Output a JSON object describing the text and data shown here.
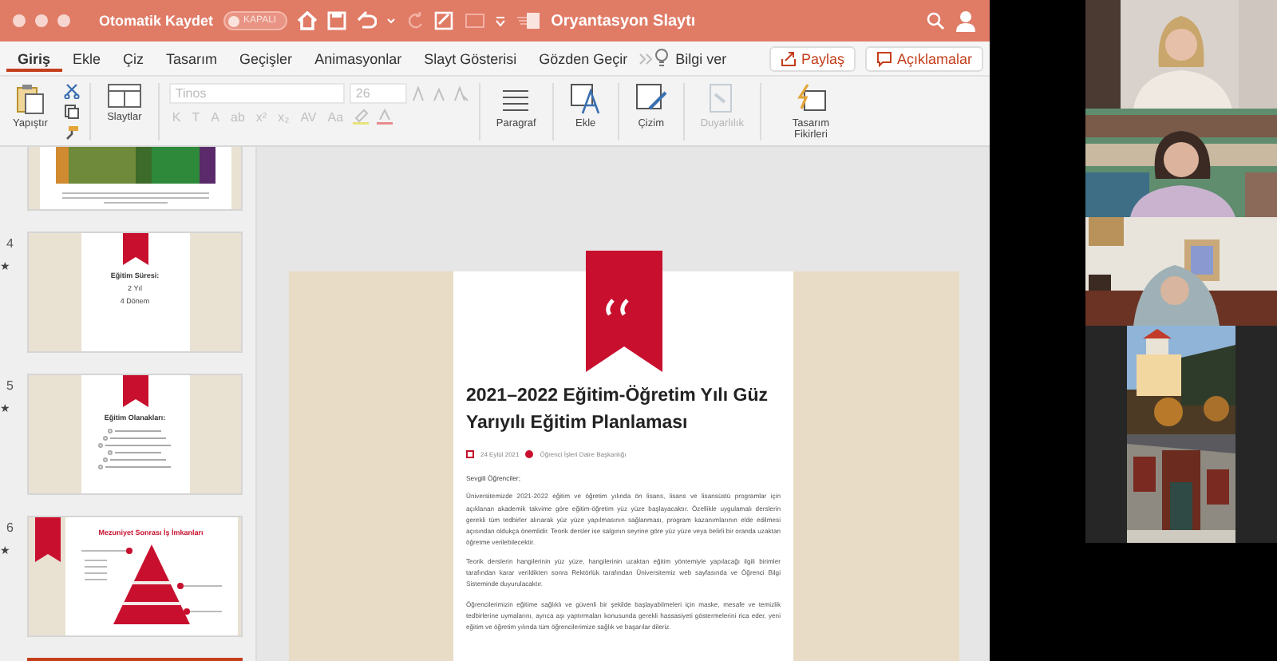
{
  "title_bar": {
    "autosave_label": "Otomatik Kaydet",
    "autosave_toggle": {
      "label": "KAPALI",
      "on": false
    },
    "document_title": "Oryantasyon Slaytı"
  },
  "ribbon_tabs": [
    {
      "label": "Giriş",
      "selected": true
    },
    {
      "label": "Ekle",
      "selected": false
    },
    {
      "label": "Çiz",
      "selected": false
    },
    {
      "label": "Tasarım",
      "selected": false
    },
    {
      "label": "Geçişler",
      "selected": false
    },
    {
      "label": "Animasyonlar",
      "selected": false
    },
    {
      "label": "Slayt Gösterisi",
      "selected": false
    },
    {
      "label": "Gözden Geçir",
      "selected": false
    }
  ],
  "tell_me": "Bilgi ver",
  "share_button": "Paylaş",
  "comments_button": "Açıklamalar",
  "toolbar": {
    "paste_label": "Yapıştır",
    "slides_label": "Slaytlar",
    "font_name": "Tinos",
    "font_size": "26",
    "format_buttons": [
      {
        "label": "K",
        "disabled": true
      },
      {
        "label": "T",
        "disabled": true
      },
      {
        "label": "A",
        "disabled": true
      },
      {
        "label": "ab",
        "disabled": true
      },
      {
        "label": "x²",
        "disabled": true
      },
      {
        "label": "x₂",
        "disabled": true
      },
      {
        "label": "AV",
        "disabled": true
      },
      {
        "label": "Aa",
        "disabled": true
      }
    ],
    "groups": [
      {
        "kind": "paragraph",
        "label": "Paragraf",
        "disabled": false
      },
      {
        "kind": "insert",
        "label": "Ekle",
        "disabled": false
      },
      {
        "kind": "drawing",
        "label": "Çizim",
        "disabled": false
      },
      {
        "kind": "sensitivity",
        "label": "Duyarlılık",
        "disabled": true
      },
      {
        "kind": "designer",
        "label": "Tasarım Fikirleri",
        "disabled": false
      }
    ]
  },
  "slides": [
    {
      "kind": "photos",
      "selected": false
    },
    {
      "kind": "title",
      "number": "4",
      "marker": "★",
      "title": "Eğitim Süresi:",
      "lines": [
        "2 Yıl",
        "4 Dönem"
      ],
      "selected": false
    },
    {
      "kind": "bullets",
      "number": "5",
      "marker": "★",
      "title": "Eğitim Olanakları:",
      "selected": false
    },
    {
      "kind": "pyramid",
      "number": "6",
      "marker": "★",
      "title": "Mezuniyet Sonrası İş İmkanları",
      "selected": false
    },
    {
      "kind": "current",
      "selected": true
    }
  ],
  "current_slide": {
    "title": "2021–2022 Eğitim-Öğretim Yılı Güz Yarıyılı Eğitim Planlaması",
    "date": "24 Eylül 2021",
    "author": "Öğrenci İşleri Daire Başkanlığı",
    "greeting": "Sevgili Öğrenciler;",
    "paragraphs": [
      "Üniversitemizde 2021-2022 eğitim ve öğretim yılında ön lisans, lisans ve lisansüstü programlar için açıklanan akademik takvime göre eğitim-öğretim yüz yüze başlayacaktır. Özellikle uygulamalı derslerin gerekli tüm tedbirler alınarak yüz yüze yapılmasının sağlanması, program kazanımlarının elde edilmesi açısından oldukça önemlidir. Teorik dersler ise salgının seyrine göre yüz yüze veya belirli bir oranda uzaktan öğretme verilebilecektir.",
      "Teorik derslerin hangilerinin yüz yüze, hangilerinin uzaktan eğitim yöntemiyle yapılacağı ilgili birimler tarafından karar verildikten sonra Rektörlük tarafından Üniversitemiz web sayfasında ve Öğrenci Bilgi Sisteminde duyurulacaktır.",
      "Öğrencilerimizin eğitime sağlıklı ve güvenli bir şekilde başlayabilmeleri için maske, mesafe ve temizlik tedbirlerine uymalarını, ayrıca aşı yaptırmaları konusunda gerekli hassasiyeti göstermelerini rica eder, yeni eğitim ve öğretim yılında tüm öğrencilerimize sağlık ve başarılar dileriz."
    ]
  }
}
